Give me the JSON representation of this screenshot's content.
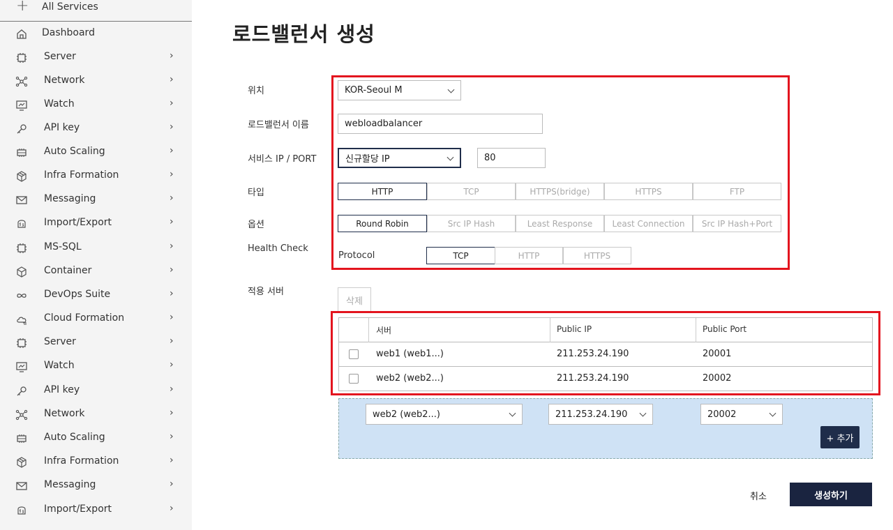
{
  "sidebar": {
    "all_services": "All Services",
    "items": [
      {
        "label": "Dashboard",
        "icon": "home-icon"
      },
      {
        "label": "Server",
        "icon": "chip-icon"
      },
      {
        "label": "Network",
        "icon": "network-icon"
      },
      {
        "label": "Watch",
        "icon": "monitor-chart-icon"
      },
      {
        "label": "API key",
        "icon": "key-icon"
      },
      {
        "label": "Auto Scaling",
        "icon": "scaling-icon"
      },
      {
        "label": "Infra Formation",
        "icon": "cube-icon"
      },
      {
        "label": "Messaging",
        "icon": "envelope-icon"
      },
      {
        "label": "Import/Export",
        "icon": "transfer-icon"
      },
      {
        "label": "MS-SQL",
        "icon": "chip-icon"
      },
      {
        "label": "Container",
        "icon": "box-icon"
      },
      {
        "label": "DevOps Suite",
        "icon": "infinity-icon"
      },
      {
        "label": "Cloud Formation",
        "icon": "cloud-icon"
      },
      {
        "label": "Server",
        "icon": "chip-icon"
      },
      {
        "label": "Watch",
        "icon": "monitor-chart-icon"
      },
      {
        "label": "API key",
        "icon": "key-icon"
      },
      {
        "label": "Network",
        "icon": "network-icon"
      },
      {
        "label": "Auto Scaling",
        "icon": "scaling-icon"
      },
      {
        "label": "Infra Formation",
        "icon": "cube-icon"
      },
      {
        "label": "Messaging",
        "icon": "envelope-icon"
      },
      {
        "label": "Import/Export",
        "icon": "transfer-icon"
      }
    ],
    "chevron": "›"
  },
  "page": {
    "title": "로드밸런서 생성"
  },
  "form": {
    "location_label": "위치",
    "location_value": "KOR-Seoul M",
    "name_label": "로드밸런서 이름",
    "name_value": "webloadbalancer",
    "service_label": "서비스 IP / PORT",
    "service_ip_value": "신규할당 IP",
    "service_port_value": "80",
    "type_label": "타입",
    "types": [
      "HTTP",
      "TCP",
      "HTTPS(bridge)",
      "HTTPS",
      "FTP"
    ],
    "type_selected": "HTTP",
    "option_label": "옵션",
    "options": [
      "Round Robin",
      "Src IP Hash",
      "Least Response",
      "Least Connection",
      "Src IP Hash+Port"
    ],
    "option_selected": "Round Robin",
    "health_label": "Health Check",
    "protocol_label": "Protocol",
    "protocols": [
      "TCP",
      "HTTP",
      "HTTPS"
    ],
    "protocol_selected": "TCP"
  },
  "servers": {
    "label": "적용 서버",
    "delete_label": "삭제",
    "columns": [
      "서버",
      "Public IP",
      "Public Port"
    ],
    "rows": [
      {
        "server": "web1 (web1...)",
        "ip": "211.253.24.190",
        "port": "20001"
      },
      {
        "server": "web2 (web2...)",
        "ip": "211.253.24.190",
        "port": "20002"
      }
    ],
    "add_server_value": "web2 (web2...)",
    "add_ip_value": "211.253.24.190",
    "add_port_value": "20002",
    "add_label": "+ 추가"
  },
  "footer": {
    "cancel_label": "취소",
    "create_label": "생성하기"
  },
  "colors": {
    "accent": "#1f2d4a",
    "highlight": "#e3141e",
    "add_area": "#cfe2f5"
  }
}
